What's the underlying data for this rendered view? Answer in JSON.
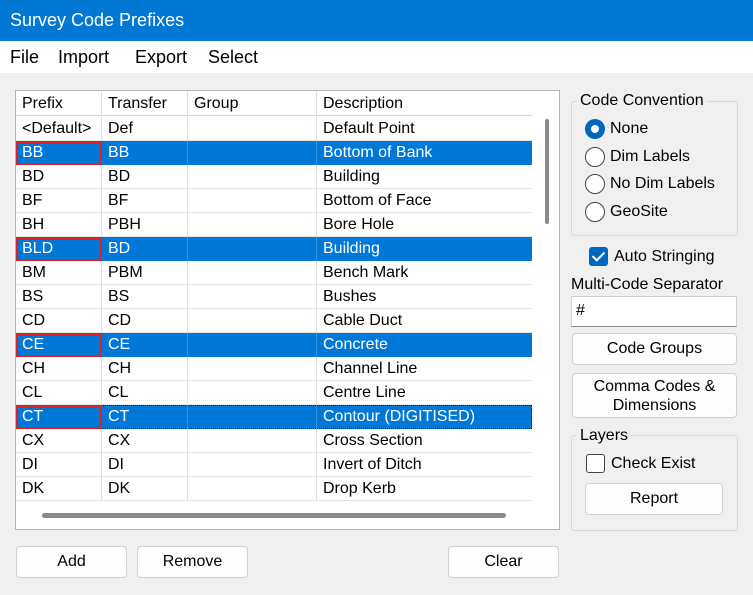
{
  "window": {
    "title": "Survey Code Prefixes"
  },
  "menu": [
    "File",
    "Import",
    "Export",
    "Select"
  ],
  "table": {
    "columns": [
      "Prefix",
      "Transfer",
      "Group",
      "Description"
    ],
    "rows": [
      [
        "<Default>",
        "Def",
        "",
        "Default Point"
      ],
      [
        "BB",
        "BB",
        "",
        "Bottom of Bank"
      ],
      [
        "BD",
        "BD",
        "",
        "Building"
      ],
      [
        "BF",
        "BF",
        "",
        "Bottom of Face"
      ],
      [
        "BH",
        "PBH",
        "",
        "Bore Hole"
      ],
      [
        "BLD",
        "BD",
        "",
        "Building"
      ],
      [
        "BM",
        "PBM",
        "",
        "Bench Mark"
      ],
      [
        "BS",
        "BS",
        "",
        "Bushes"
      ],
      [
        "CD",
        "CD",
        "",
        "Cable Duct"
      ],
      [
        "CE",
        "CE",
        "",
        "Concrete"
      ],
      [
        "CH",
        "CH",
        "",
        "Channel Line"
      ],
      [
        "CL",
        "CL",
        "",
        "Centre Line"
      ],
      [
        "CT",
        "CT",
        "",
        "Contour (DIGITISED)"
      ],
      [
        "CX",
        "CX",
        "",
        "Cross Section"
      ],
      [
        "DI",
        "DI",
        "",
        "Invert of Ditch"
      ],
      [
        "DK",
        "DK",
        "",
        "Drop Kerb"
      ]
    ],
    "selected_rows": [
      1,
      5,
      9,
      12
    ],
    "focused_row": 12
  },
  "buttons": {
    "add": "Add",
    "remove": "Remove",
    "clear": "Clear",
    "code_groups": "Code Groups",
    "comma_codes_line1": "Comma Codes &",
    "comma_codes_line2": "Dimensions",
    "report": "Report"
  },
  "code_convention": {
    "title": "Code Convention",
    "options": [
      "None",
      "Dim Labels",
      "No Dim Labels",
      "GeoSite"
    ],
    "selected": "None"
  },
  "auto_stringing": {
    "label": "Auto Stringing",
    "checked": true
  },
  "separator": {
    "label": "Multi-Code Separator",
    "value": "#"
  },
  "layers": {
    "title": "Layers",
    "check_exist_label": "Check Exist",
    "check_exist_checked": false
  },
  "colors": {
    "accent": "#0078d4",
    "selection": "#0078d7",
    "highlight_outline": "#e02020"
  }
}
